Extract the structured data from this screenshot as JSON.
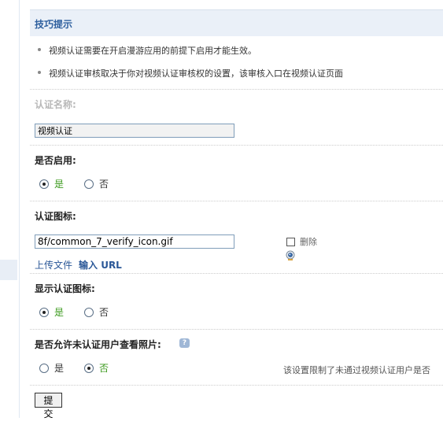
{
  "tips": {
    "title": "技巧提示",
    "items": [
      "视频认证需要在开启漫游应用的前提下启用才能生效。",
      "视频认证审核取决于你对视频认证审核权的设置，该审核入口在视频认证页面"
    ]
  },
  "form": {
    "name": {
      "label": "认证名称:",
      "value": "视频认证"
    },
    "enabled": {
      "label": "是否启用:",
      "options": [
        "是",
        "否"
      ],
      "selected": "是"
    },
    "icon": {
      "label": "认证图标:",
      "value": "8f/common_7_verify_icon.gif",
      "delete_label": "删除",
      "upload_link": "上传文件",
      "url_link": "输入 URL"
    },
    "show_icon": {
      "label": "显示认证图标:",
      "options": [
        "是",
        "否"
      ],
      "selected": "是"
    },
    "allow_view": {
      "label": "是否允许未认证用户查看照片:",
      "options": [
        "是",
        "否"
      ],
      "selected": "否",
      "note": "该设置限制了未通过视频认证用户是否"
    },
    "submit_label": "提交"
  }
}
